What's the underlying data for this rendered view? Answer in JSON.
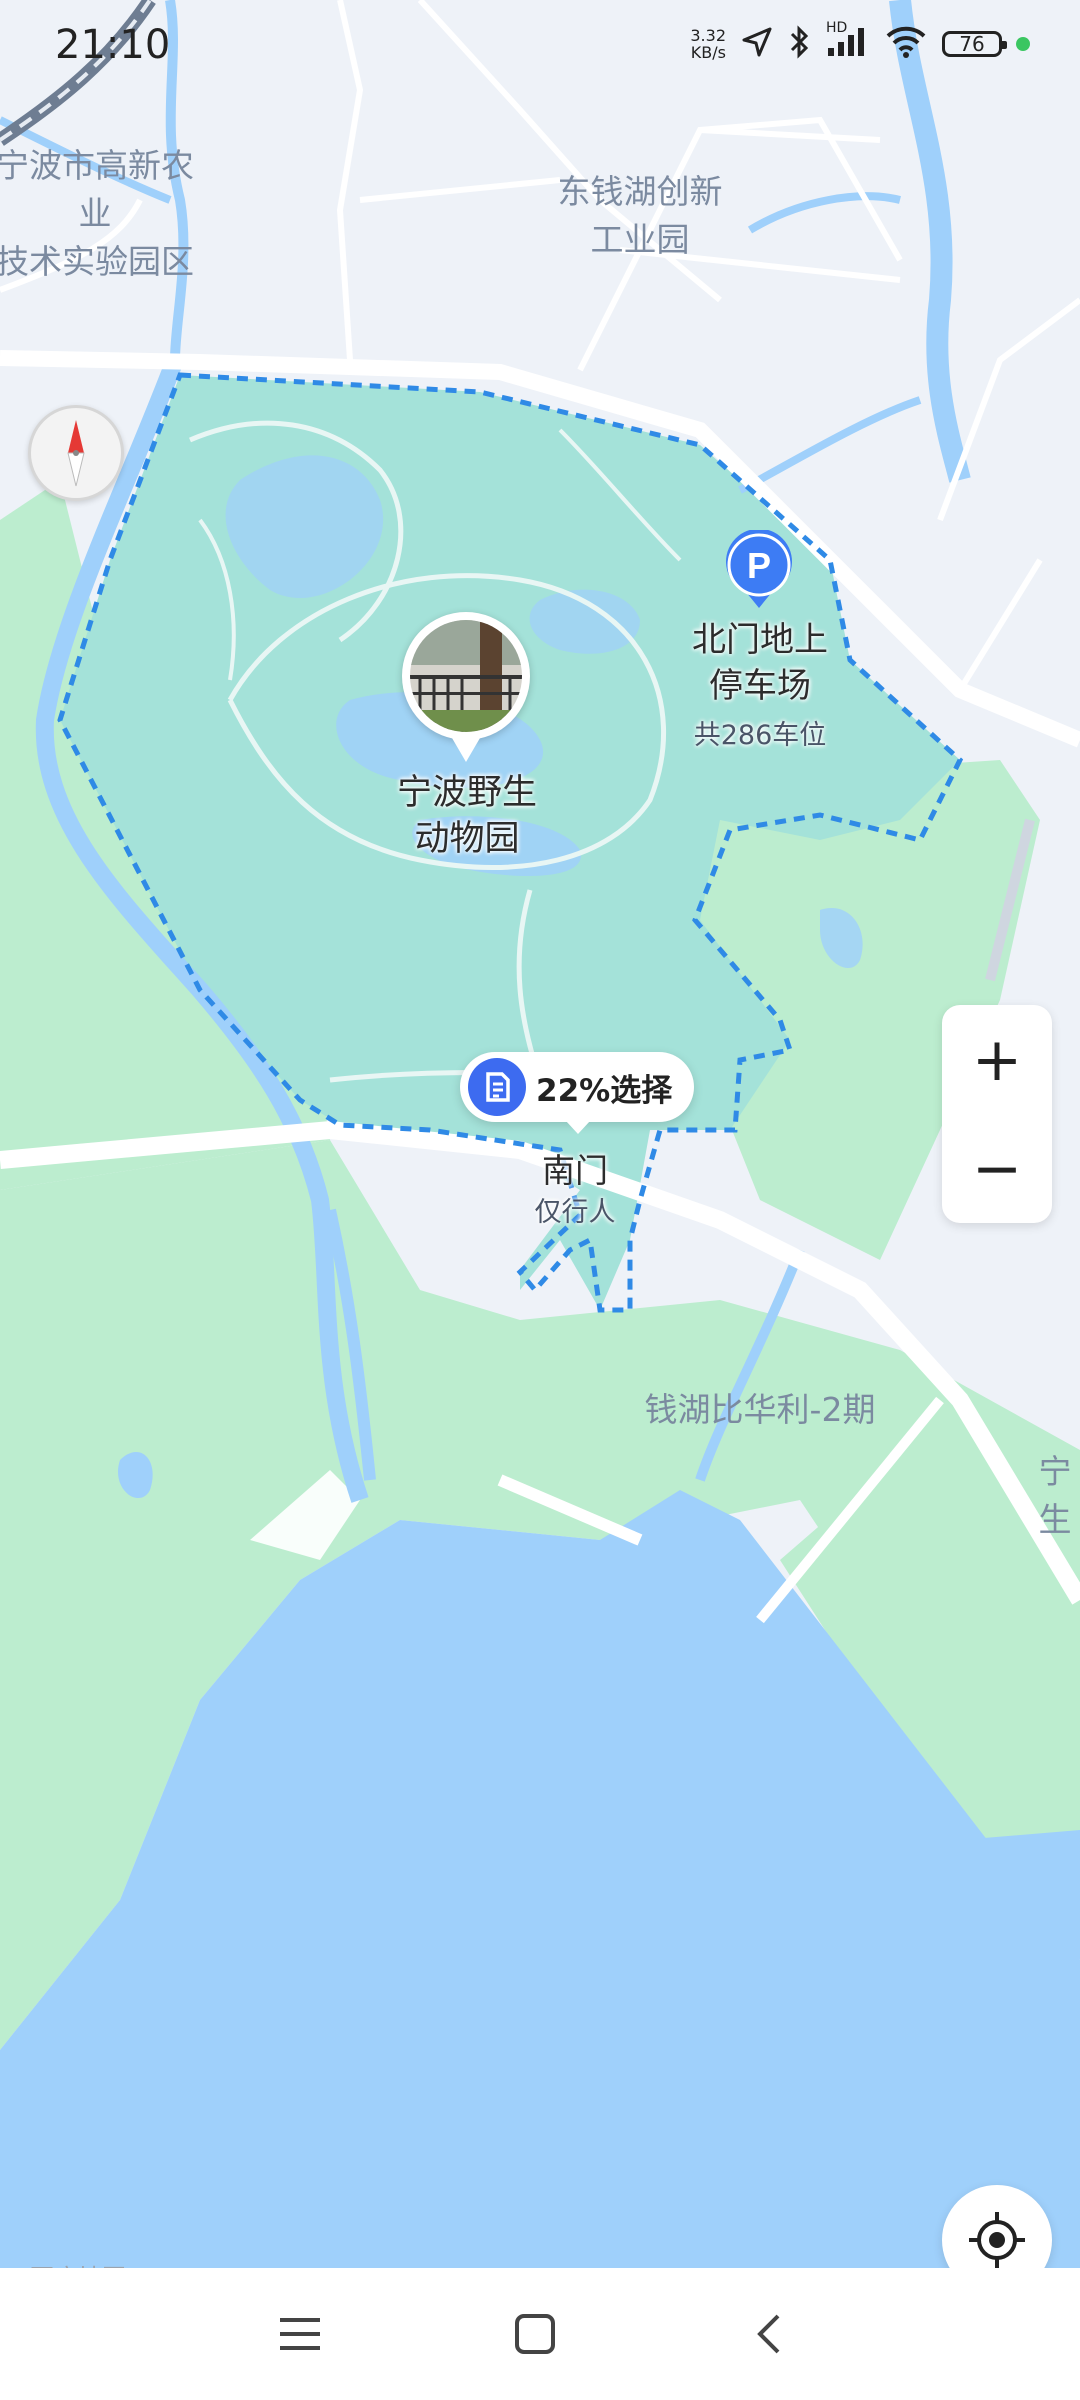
{
  "status_bar": {
    "time": "21:10",
    "net_speed_value": "3.32",
    "net_speed_unit": "KB/s",
    "hd": "HD",
    "battery": "76"
  },
  "map": {
    "area_labels": [
      {
        "text": "宁波市高新农业\n技术实验园区"
      },
      {
        "text": "东钱湖创新\n工业园"
      },
      {
        "text": "钱湖比华利-2期"
      },
      {
        "text": "宁\n生"
      }
    ],
    "zoo": {
      "name": "宁波野生\n动物园"
    },
    "parking": {
      "name": "北门地上\n停车场",
      "detail": "共286车位"
    },
    "south_gate": {
      "name": "南门",
      "detail": "仅行人"
    },
    "badge": {
      "text": "22%选择"
    },
    "watermark": "百度地图"
  },
  "controls": {
    "zoom_in": "+",
    "zoom_out": "−"
  }
}
